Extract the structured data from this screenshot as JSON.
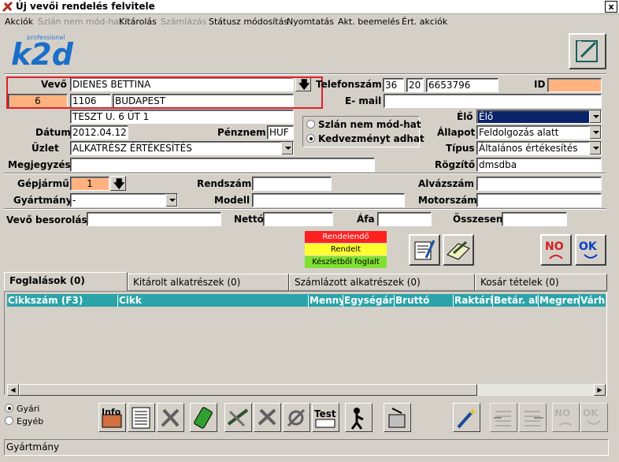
{
  "window": {
    "title": "Új vevői rendelés felvitele",
    "close_label": "x"
  },
  "menu": [
    {
      "label": "Akciók",
      "enabled": true
    },
    {
      "label": "Szlán nem mód-hat",
      "enabled": false
    },
    {
      "label": "Kitárolás",
      "enabled": true
    },
    {
      "label": "Számlázás",
      "enabled": false
    },
    {
      "label": "Státusz módosítás",
      "enabled": true
    },
    {
      "label": "Nyomtatás",
      "enabled": true
    },
    {
      "label": "Akt. beemelés",
      "enabled": true
    },
    {
      "label": "Ért. akciók",
      "enabled": true
    }
  ],
  "logo": {
    "text": "k2d",
    "sub": "professional"
  },
  "form": {
    "vevo_label": "Vevő",
    "vevo_value": "DIENES BETTINA",
    "vevo_code": "6",
    "zip": "1106",
    "city": "BUDAPEST",
    "address": "TESZT U. 6 ÚT 1",
    "telefon_label": "Telefonszám",
    "tel1": "36",
    "tel2": "20",
    "tel3": "6653796",
    "id_label": "ID",
    "id_value": "",
    "email_label": "E- mail",
    "email_value": "",
    "elo_label": "Élő",
    "elo_value": "Élő",
    "datum_label": "Dátum",
    "datum_value": "2012.04.12.",
    "penznem_label": "Pénznem",
    "penznem_value": "HUF",
    "allapot_label": "Állapot",
    "allapot_value": "Feldolgozás alatt",
    "uzlet_label": "Üzlet",
    "uzlet_value": "ALKATRÉSZ ÉRTÉKESÍTÉS",
    "tipus_label": "Típus",
    "tipus_value": "Általános értékesítés",
    "megjegyzes_label": "Megjegyzés",
    "megjegyzes_value": "",
    "rogzito_label": "Rögzítő",
    "rogzito_value": "dmsdba",
    "radio1": "Szlán nem mód-hat",
    "radio2": "Kedvezményt adhat",
    "gepjarmu_label": "Gépjármű",
    "gepjarmu_value": "1",
    "rendszam_label": "Rendszám",
    "rendszam_value": "",
    "alvazszam_label": "Alvázszám",
    "alvazszam_value": "",
    "gyartmany_label": "Gyártmány",
    "gyartmany_value": "-",
    "modell_label": "Modell",
    "modell_value": "",
    "motorszam_label": "Motorszám",
    "motorszam_value": "",
    "besorolas_label": "Vevő besorolás",
    "besorolas_value": "",
    "netto_label": "Nettó",
    "netto_value": "",
    "afa_label": "Áfa",
    "afa_value": "",
    "osszesen_label": "Összesen",
    "osszesen_value": ""
  },
  "legend": [
    {
      "label": "Rendelendő",
      "color": "#ff2020"
    },
    {
      "label": "Rendelt",
      "color": "#ffff30"
    },
    {
      "label": "Készletből foglalt",
      "color": "#80e030"
    }
  ],
  "tabs": [
    "Foglalások (0)",
    "Kitárolt alkatrészek (0)",
    "Számlázott alkatrészek (0)",
    "Kosár tételek (0)"
  ],
  "grid_columns": [
    "Cikkszám (F3)",
    "Cikk",
    "Menny",
    "Egységár",
    "Bruttó",
    "Raktári",
    "Betár. al-",
    "Megren",
    "Várha"
  ],
  "bottom_radio": {
    "gyari": "Gyári",
    "egyeb": "Egyéb"
  },
  "ok_label": "OK",
  "no_label": "NO",
  "info_label": "Info",
  "test_label": "Test",
  "status_text": "Gyártmány"
}
